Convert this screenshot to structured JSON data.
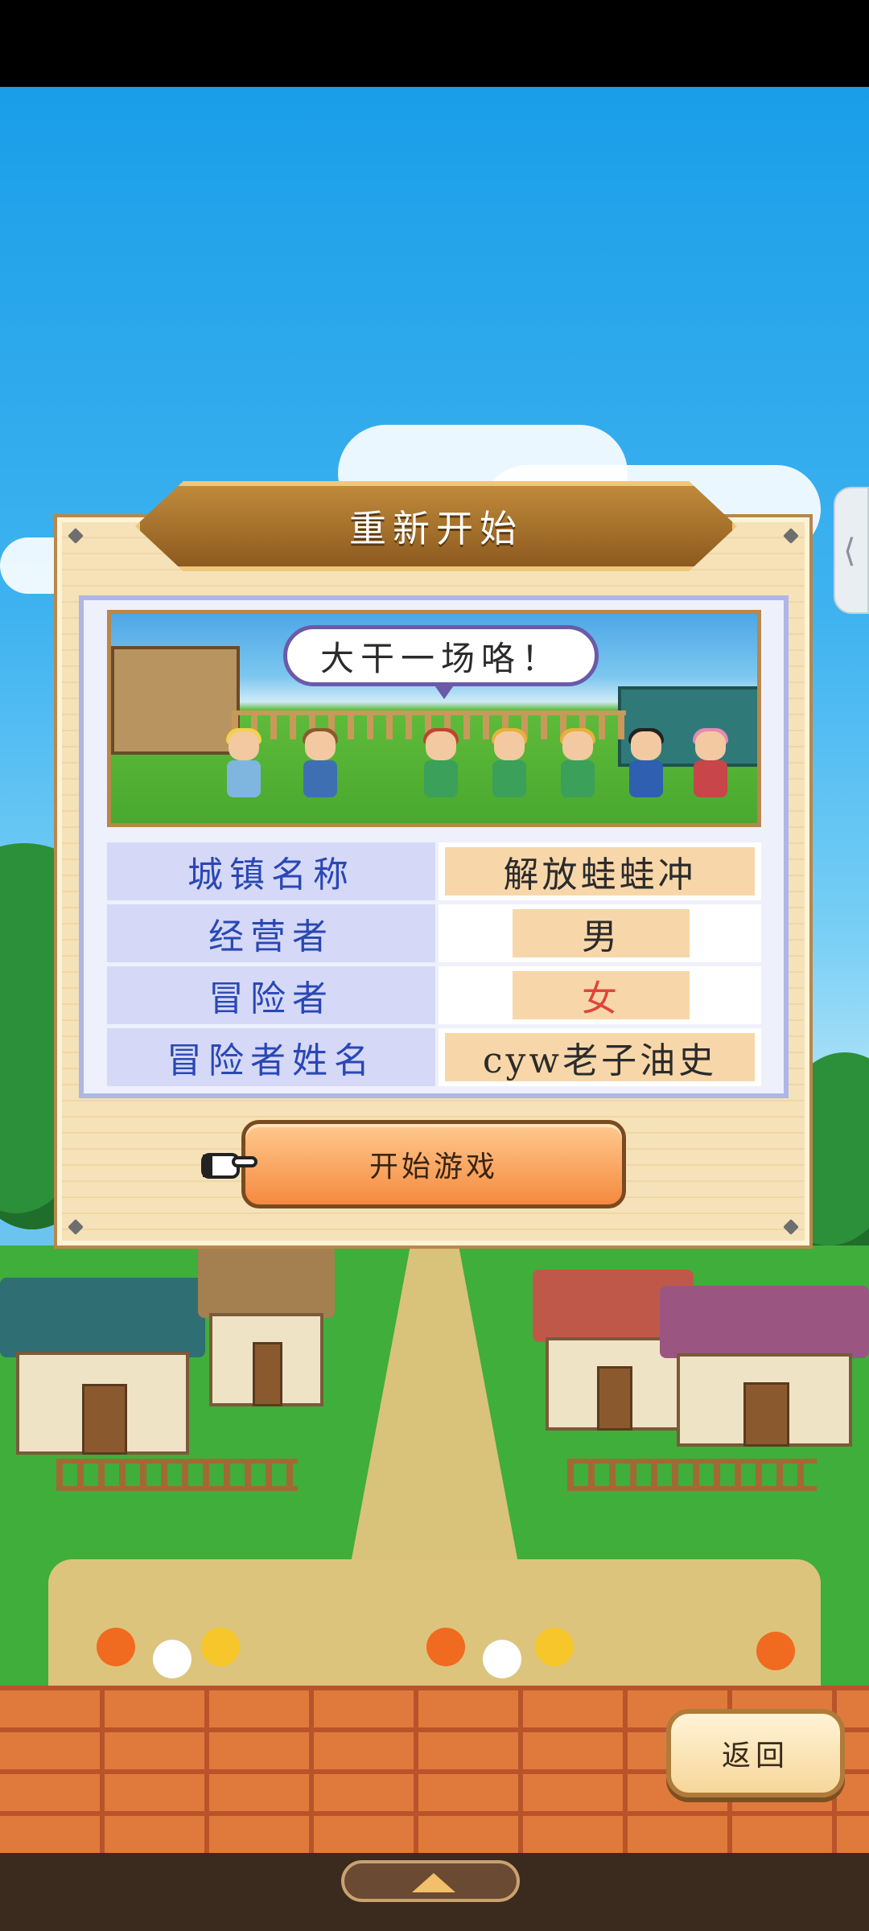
{
  "dialog": {
    "title": "重新开始",
    "banner_speech": "大干一场咯！",
    "rows": [
      {
        "label": "城镇名称",
        "value": "解放蛙蛙冲"
      },
      {
        "label": "经营者",
        "value": "男"
      },
      {
        "label": "冒险者",
        "value": "女"
      },
      {
        "label": "冒险者姓名",
        "value": "cyw老子油史"
      }
    ],
    "start_label": "开始游戏"
  },
  "back_label": "返回",
  "colors": {
    "label_text": "#2a47b5",
    "female_value": "#e0443a",
    "start_button": "#f58a3f"
  },
  "icons": {
    "pointer": "hand-pointer-icon",
    "side_handle": "chevron-left-icon",
    "bottom_tab": "triangle-up-icon"
  }
}
